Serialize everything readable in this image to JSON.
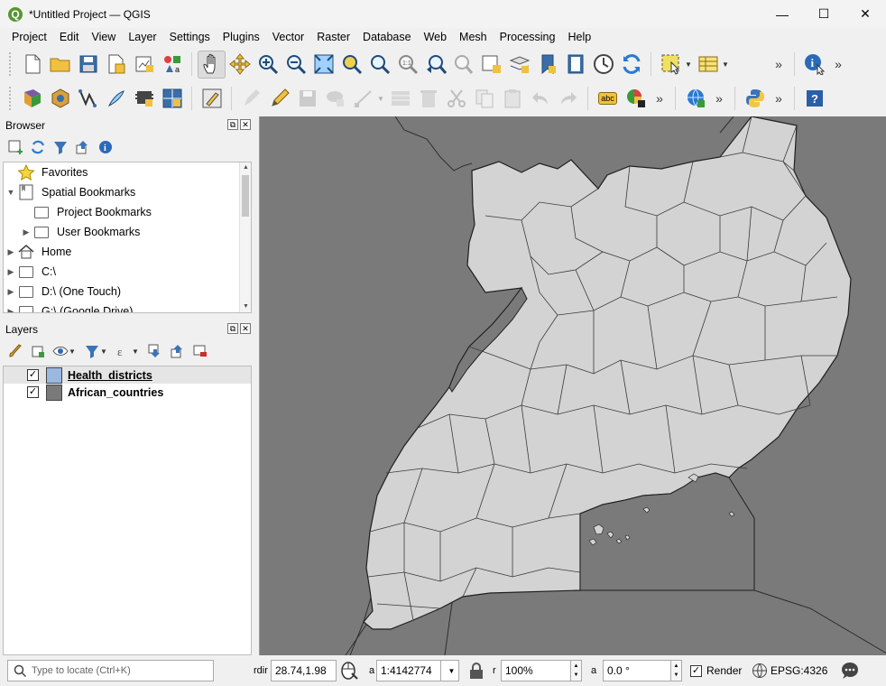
{
  "window": {
    "title": "*Untitled Project — QGIS",
    "logo_letter": "Q"
  },
  "menu": [
    "Project",
    "Edit",
    "View",
    "Layer",
    "Settings",
    "Plugins",
    "Vector",
    "Raster",
    "Database",
    "Web",
    "Mesh",
    "Processing",
    "Help"
  ],
  "toolbar1": {
    "icons": [
      "new-project-icon",
      "open-project-icon",
      "save-project-icon",
      "save-as-icon",
      "print-layout-icon",
      "style-manager-icon",
      "pan-icon",
      "pan-to-selection-icon",
      "zoom-in-icon",
      "zoom-out-icon",
      "zoom-full-icon",
      "zoom-to-selection-icon",
      "zoom-to-layer-icon",
      "zoom-native-icon",
      "zoom-last-icon",
      "zoom-next-icon",
      "new-bookmark-icon",
      "show-bookmarks-icon",
      "temporal-controller-icon",
      "refresh-icon",
      "select-features-icon",
      "attribute-table-icon",
      "identify-icon"
    ]
  },
  "toolbar2": {
    "icons": [
      "data-source-manager-icon",
      "new-geopackage-icon",
      "new-shapefile-icon",
      "new-spatialite-icon",
      "new-virtual-layer-icon",
      "new-temp-layer-icon",
      "digitizing-icon",
      "edit-pencil-icon",
      "save-edits-icon",
      "add-feature-icon",
      "vertex-tool-icon",
      "modify-attributes-icon",
      "delete-icon",
      "cut-icon",
      "copy-icon",
      "paste-icon",
      "undo-icon",
      "redo-icon",
      "label-icon",
      "diagram-icon",
      "globe-icon",
      "python-icon",
      "help-icon"
    ],
    "label_icon_text": "abc"
  },
  "browser": {
    "title": "Browser",
    "items": [
      {
        "label": "Favorites",
        "icon": "star-icon",
        "arrow": ""
      },
      {
        "label": "Spatial Bookmarks",
        "icon": "bookmark-icon",
        "arrow": "▼"
      },
      {
        "label": "Project Bookmarks",
        "icon": "folder-icon",
        "arrow": ""
      },
      {
        "label": "User Bookmarks",
        "icon": "folder-icon",
        "arrow": "▶"
      },
      {
        "label": "Home",
        "icon": "home-icon",
        "arrow": "▶"
      },
      {
        "label": "C:\\",
        "icon": "drive-icon",
        "arrow": "▶"
      },
      {
        "label": "D:\\ (One Touch)",
        "icon": "drive-icon",
        "arrow": "▶"
      },
      {
        "label": "G:\\ (Google Drive)",
        "icon": "drive-icon",
        "arrow": "▶"
      }
    ]
  },
  "layers": {
    "title": "Layers",
    "items": [
      {
        "name": "Health_districts",
        "checked": "✓",
        "color": "#9ab8e0"
      },
      {
        "name": "African_countries",
        "checked": "✓",
        "color": "#7a7a7a"
      }
    ]
  },
  "status": {
    "locator_placeholder": "Type to locate (Ctrl+K)",
    "coord_label": "rdir",
    "coordinate": "28.74,1.98",
    "scale_label": "a",
    "scale": "1:4142774",
    "magnifier_label": "r",
    "magnification": "100%",
    "rotation_label": "a",
    "rotation": "0.0 °",
    "render_label": "Render",
    "render_checked": "✓",
    "crs": "EPSG:4326"
  },
  "map_colors": {
    "background": "#7a7a7a",
    "country_fill": "#d3d3d3",
    "district_stroke": "#3a3a3a"
  }
}
